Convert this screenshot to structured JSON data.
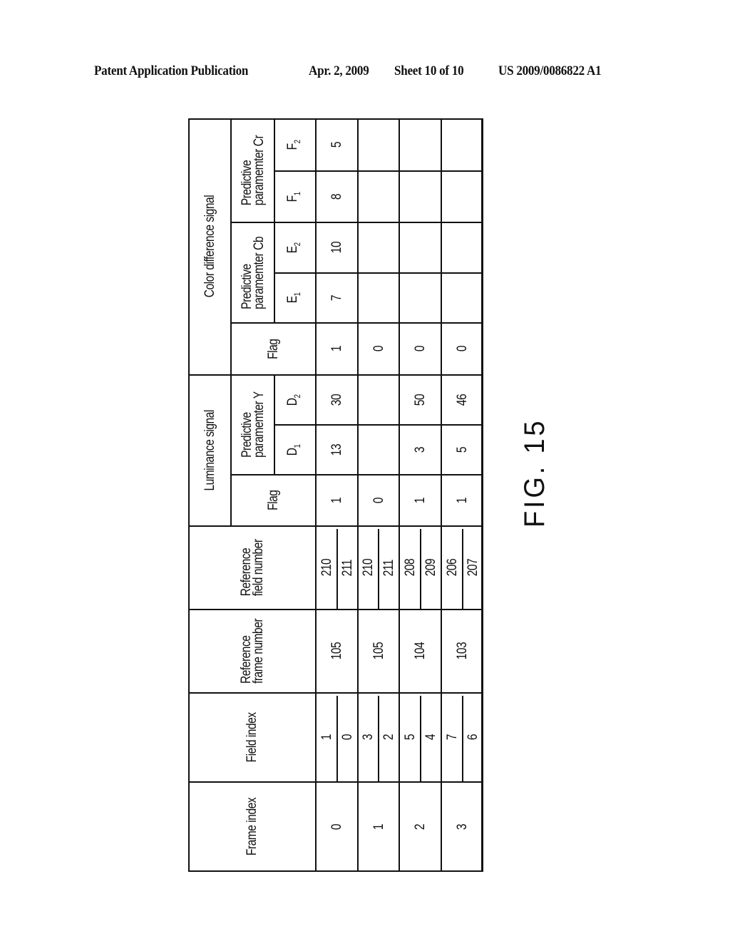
{
  "header": {
    "publication": "Patent Application Publication",
    "date": "Apr. 2, 2009",
    "sheet": "Sheet 10 of 10",
    "number": "US 2009/0086822 A1"
  },
  "figure": {
    "label": "FIG. 15"
  },
  "table": {
    "headers": {
      "frame_index": "Frame index",
      "field_index": "Field index",
      "ref_frame": [
        "Reference",
        "frame number"
      ],
      "ref_field": [
        "Reference",
        "field number"
      ],
      "luminance_group": "Luminance signal",
      "lum_flag": "Flag",
      "pred_y": [
        "Predictive",
        "paramemter  Y"
      ],
      "d1": {
        "base": "D",
        "sub": "1"
      },
      "d2": {
        "base": "D",
        "sub": "2"
      },
      "color_group": "Color difference signal",
      "cd_flag": "Flag",
      "pred_cb": [
        "Predictive",
        "paramemter  Cb"
      ],
      "e1": {
        "base": "E",
        "sub": "1"
      },
      "e2": {
        "base": "E",
        "sub": "2"
      },
      "pred_cr": [
        "Predictive",
        "paramemter  Cr"
      ],
      "f1": {
        "base": "F",
        "sub": "1"
      },
      "f2": {
        "base": "F",
        "sub": "2"
      }
    },
    "rows": [
      {
        "frame_index": "0",
        "field_index": [
          "1",
          "0"
        ],
        "ref_frame": "105",
        "ref_field": [
          "210",
          "211"
        ],
        "lum_flag": "1",
        "d1": "13",
        "d2": "30",
        "cd_flag": "1",
        "e1": "7",
        "e2": "10",
        "f1": "8",
        "f2": "5"
      },
      {
        "frame_index": "1",
        "field_index": [
          "3",
          "2"
        ],
        "ref_frame": "105",
        "ref_field": [
          "210",
          "211"
        ],
        "lum_flag": "0",
        "d1": "",
        "d2": "",
        "cd_flag": "0",
        "e1": "",
        "e2": "",
        "f1": "",
        "f2": ""
      },
      {
        "frame_index": "2",
        "field_index": [
          "5",
          "4"
        ],
        "ref_frame": "104",
        "ref_field": [
          "208",
          "209"
        ],
        "lum_flag": "1",
        "d1": "3",
        "d2": "50",
        "cd_flag": "0",
        "e1": "",
        "e2": "",
        "f1": "",
        "f2": ""
      },
      {
        "frame_index": "3",
        "field_index": [
          "7",
          "6"
        ],
        "ref_frame": "103",
        "ref_field": [
          "206",
          "207"
        ],
        "lum_flag": "1",
        "d1": "5",
        "d2": "46",
        "cd_flag": "0",
        "e1": "",
        "e2": "",
        "f1": "",
        "f2": ""
      }
    ]
  }
}
